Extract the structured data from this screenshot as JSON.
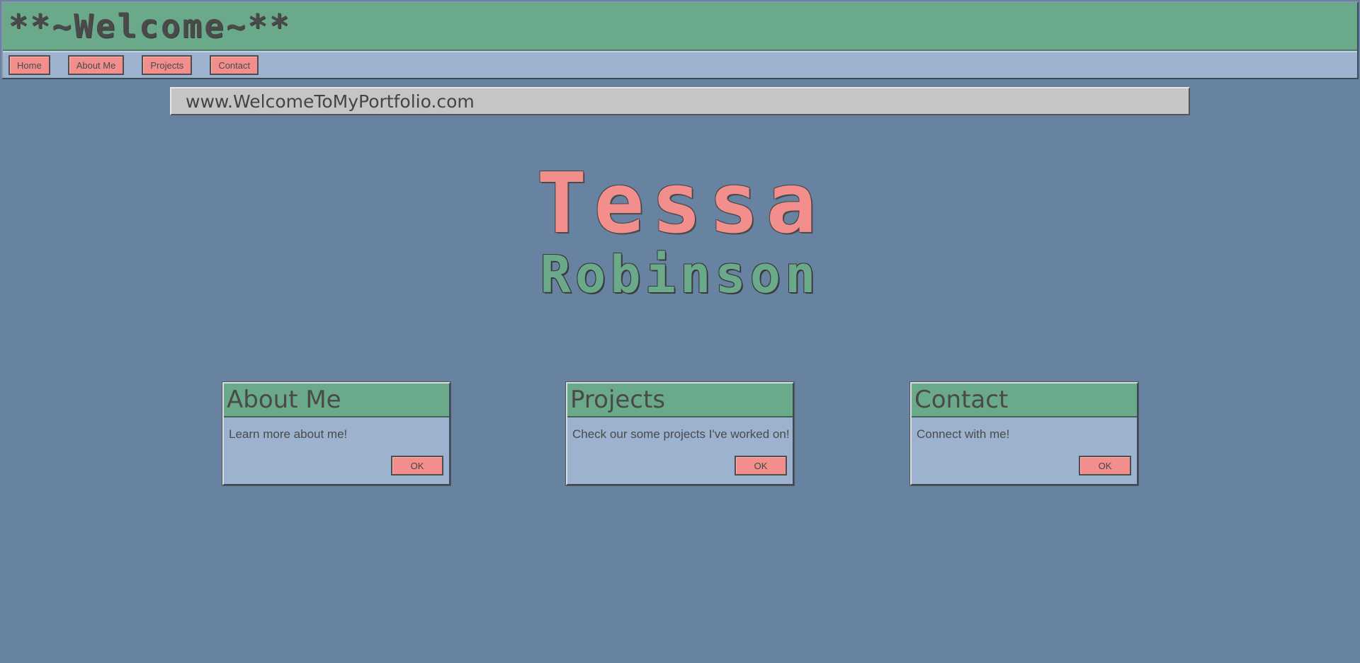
{
  "header": {
    "title": "**~Welcome~**"
  },
  "nav": {
    "items": [
      {
        "label": "Home"
      },
      {
        "label": "About Me"
      },
      {
        "label": "Projects"
      },
      {
        "label": "Contact"
      }
    ]
  },
  "url_bar": {
    "text": "www.WelcomeToMyPortfolio.com"
  },
  "hero": {
    "first_name": "Tessa",
    "last_name": "Robinson"
  },
  "cards": [
    {
      "title": "About Me",
      "text": "Learn more about me!",
      "button": "OK"
    },
    {
      "title": "Projects",
      "text": "Check our some projects I've worked on!",
      "button": "OK"
    },
    {
      "title": "Contact",
      "text": "Connect with me!",
      "button": "OK"
    }
  ],
  "colors": {
    "background": "#6783a1",
    "title_bar": "#6aa98a",
    "nav_bar": "#9cb2cf",
    "button": "#f28e8c",
    "url_bar": "#c5c5c5"
  }
}
